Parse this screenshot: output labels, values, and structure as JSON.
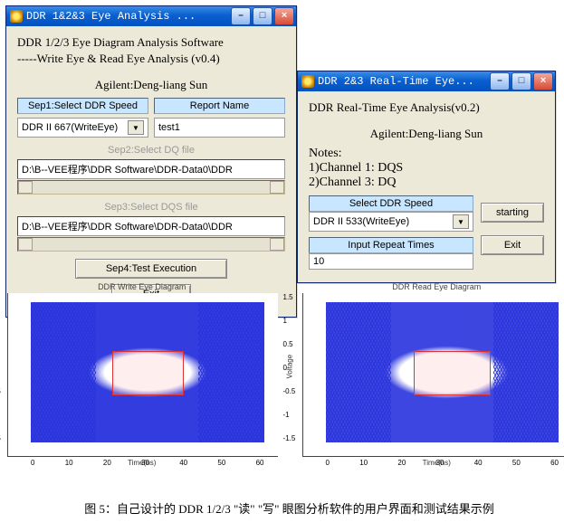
{
  "window1": {
    "title": "DDR 1&2&3 Eye Analysis ...",
    "heading": "DDR 1/2/3  Eye Diagram Analysis Software",
    "sub": "-----Write Eye & Read Eye Analysis (v0.4)",
    "brand": "Agilent:Deng-liang Sun",
    "step1_label": "Sep1:Select DDR Speed",
    "report_label": "Report Name",
    "ddr_speed": "DDR II 667(WriteEye)",
    "report_value": "test1",
    "step2_label": "Sep2:Select DQ file",
    "path1": "D:\\B--VEE程序\\DDR Software\\DDR-Data0\\DDR",
    "step3_label": "Sep3:Select DQS file",
    "path2": "D:\\B--VEE程序\\DDR Software\\DDR-Data0\\DDR",
    "step4_label": "Sep4:Test Execution",
    "exit_label": "Exit"
  },
  "window2": {
    "title": "DDR 2&3 Real-Time Eye...",
    "heading": "DDR Real-Time Eye Analysis(v0.2)",
    "brand": "Agilent:Deng-liang Sun",
    "notes_title": "Notes:",
    "note1": "1)Channel 1: DQS",
    "note2": "2)Channel 3: DQ",
    "select_label": "Select DDR Speed",
    "ddr_speed": "DDR II 533(WriteEye)",
    "repeat_label": "Input Repeat Times",
    "repeat_value": "10",
    "starting_label": "starting",
    "exit_label": "Exit"
  },
  "charts": {
    "left_title": "DDR Write Eye Diagram",
    "right_title": "DDR Read Eye Diagram",
    "xlabel": "Time(ns)",
    "ylabel": "Voltage"
  },
  "chart_data": [
    {
      "type": "line",
      "title": "DDR Write Eye Diagram",
      "xlabel": "Time(ns)",
      "ylabel": "Voltage",
      "xlim": [
        0,
        60
      ],
      "ylim": [
        -1.5,
        1.5
      ],
      "x_ticks": [
        0,
        10,
        20,
        30,
        40,
        50,
        60
      ],
      "y_ticks": [
        -1.5,
        -1,
        -0.5,
        0,
        0.5,
        1,
        1.5
      ],
      "note": "dense overlaid eye-diagram traces; open eye centered ~25-40ns; red mask box inside eye"
    },
    {
      "type": "line",
      "title": "DDR Read Eye Diagram",
      "xlabel": "Time(ns)",
      "ylabel": "Voltage",
      "xlim": [
        0,
        60
      ],
      "ylim": [
        -1.5,
        1.5
      ],
      "x_ticks": [
        0,
        10,
        20,
        30,
        40,
        50,
        60
      ],
      "y_ticks": [
        -1.5,
        -1,
        -0.5,
        0,
        0.5,
        1,
        1.5
      ],
      "note": "dense overlaid eye-diagram traces; open eye centered ~25-45ns; red mask box inside eye"
    }
  ],
  "caption": "图 5：自己设计的 DDR 1/2/3 \"读\" \"写\" 眼图分析软件的用户界面和测试结果示例"
}
